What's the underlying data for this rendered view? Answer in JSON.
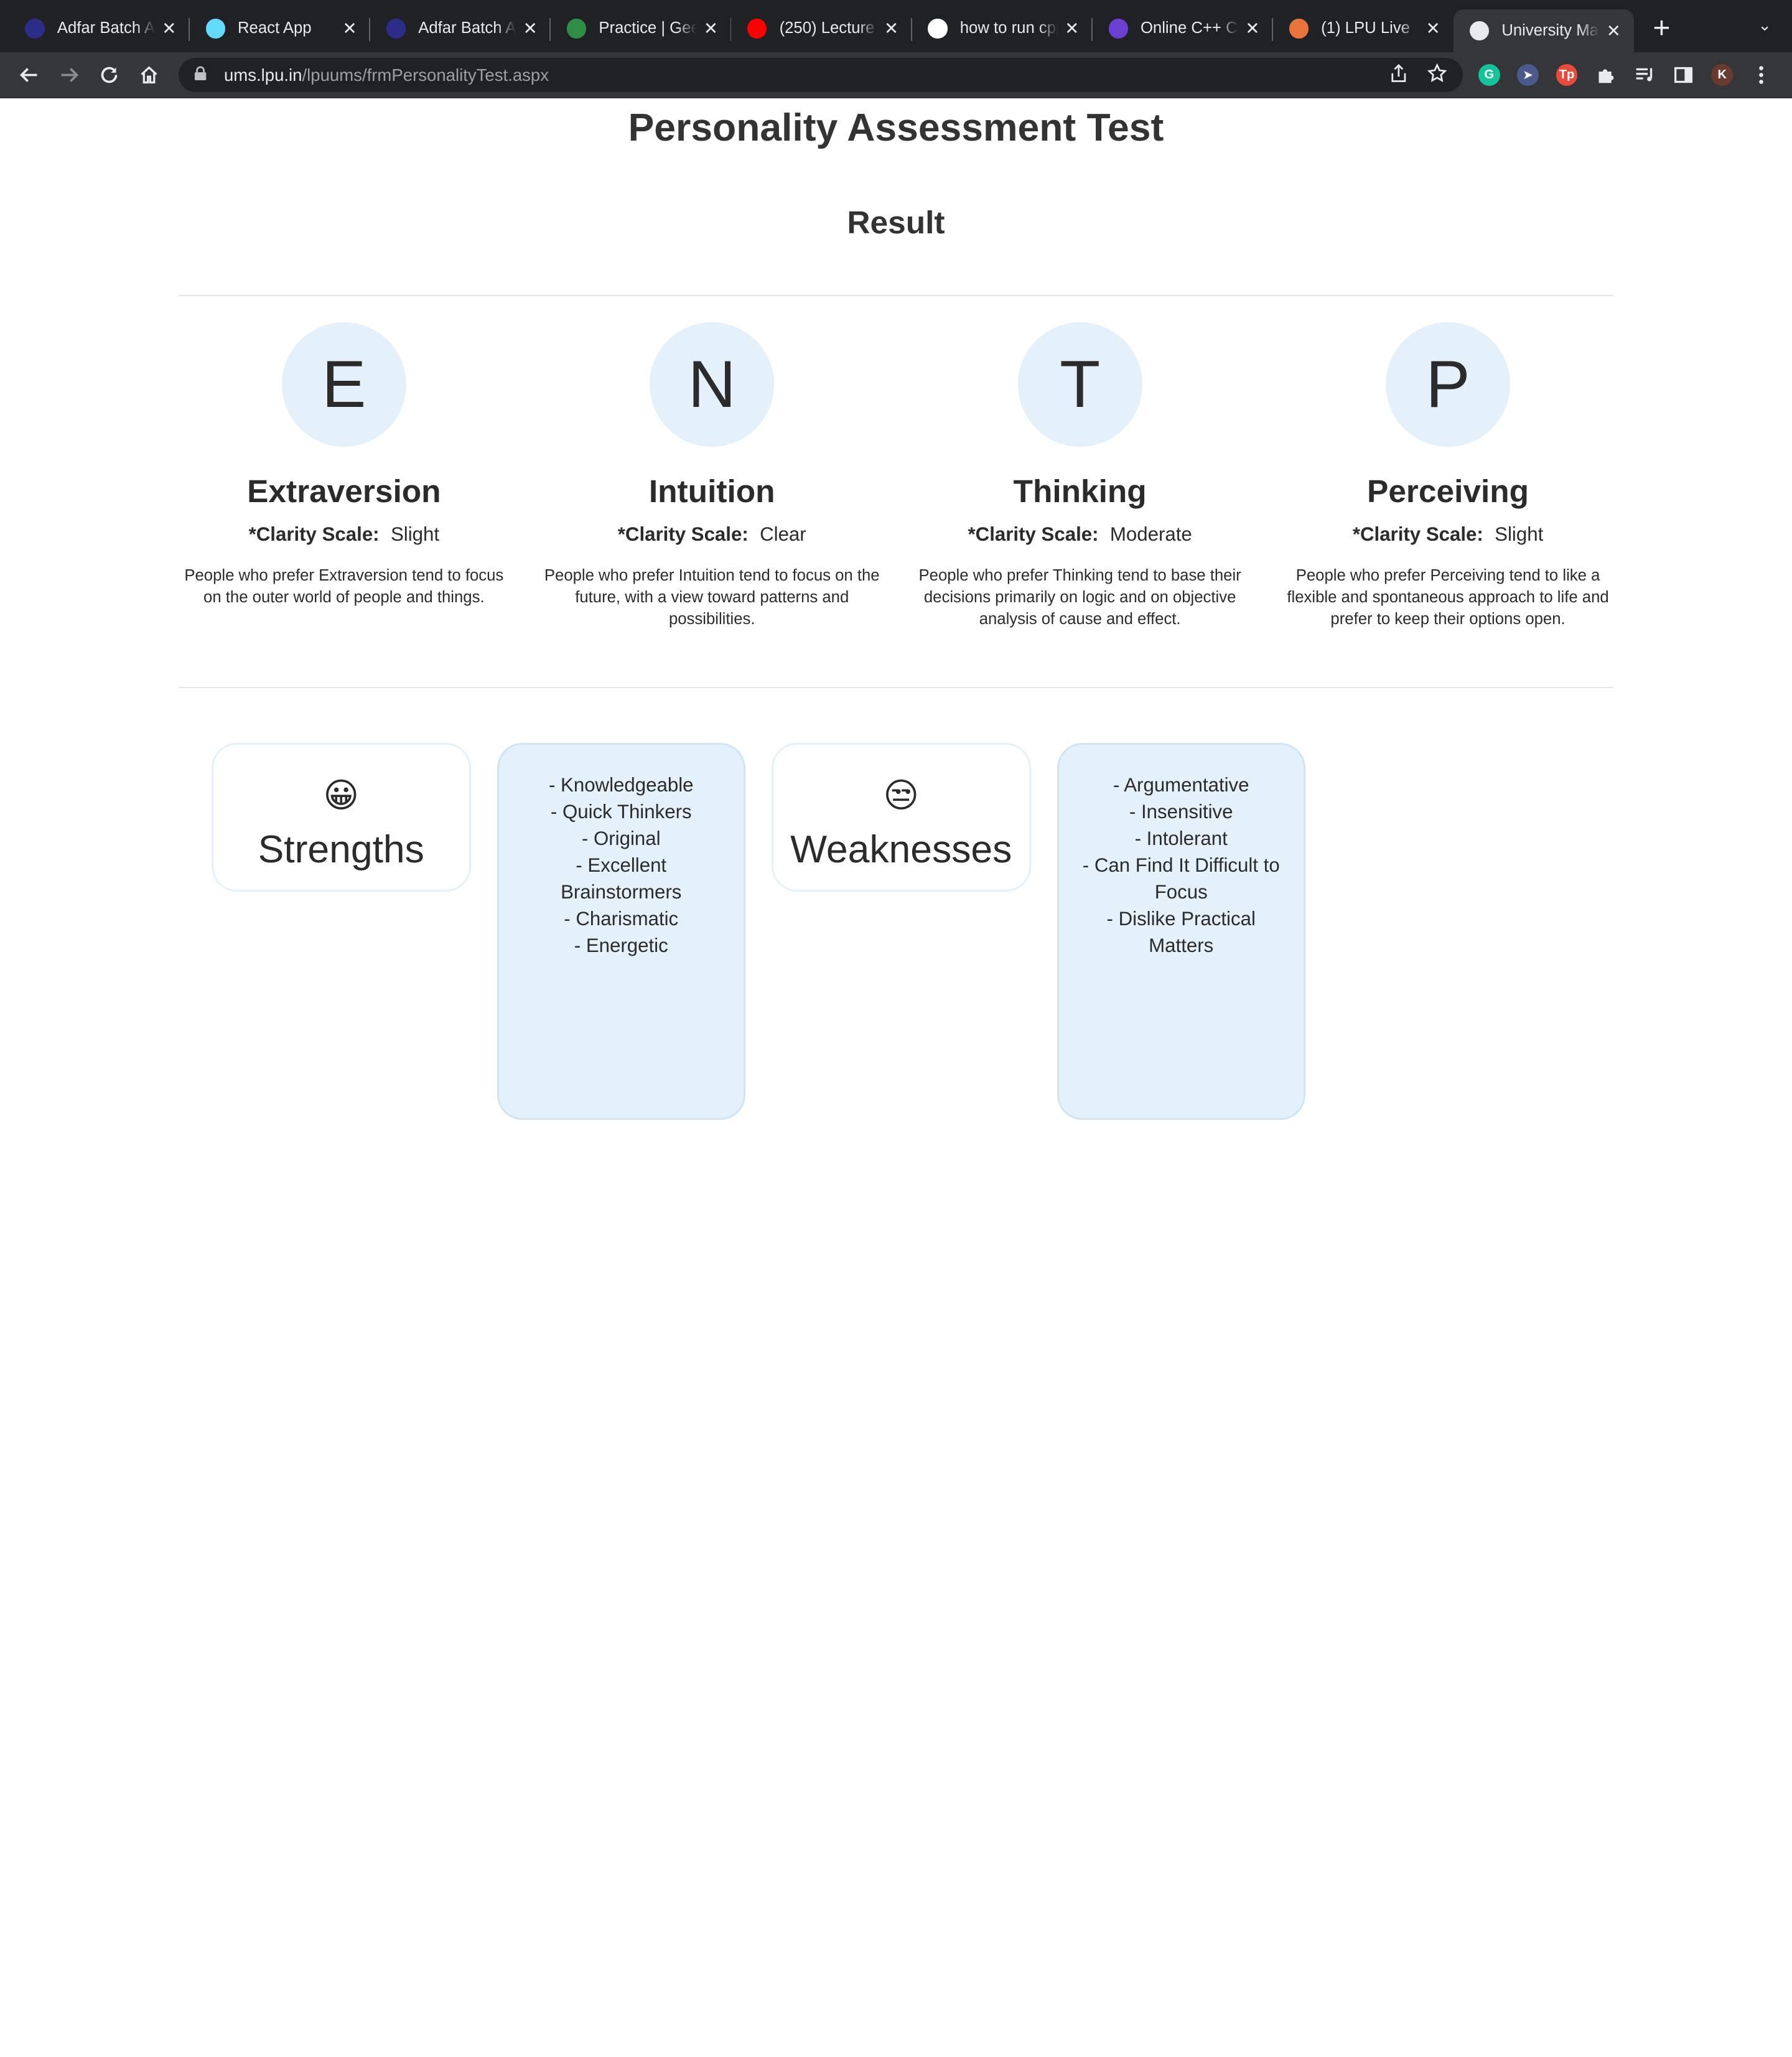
{
  "browser": {
    "tabs": [
      {
        "title": "Adfar Batch A",
        "icon": "coding-platform-icon",
        "color": "#2c2c8a",
        "active": false
      },
      {
        "title": "React App",
        "icon": "react-icon",
        "color": "#61dafb",
        "active": false
      },
      {
        "title": "Adfar Batch A",
        "icon": "coding-platform-icon",
        "color": "#2c2c8a",
        "active": false
      },
      {
        "title": "Practice | Geel",
        "icon": "geeksforgeeks-icon",
        "color": "#2f8d46",
        "active": false
      },
      {
        "title": "(250) Lecture",
        "icon": "youtube-icon",
        "color": "#ff0000",
        "active": false
      },
      {
        "title": "how to run cpp",
        "icon": "google-icon",
        "color": "#ffffff",
        "active": false
      },
      {
        "title": "Online C++ Co",
        "icon": "bolt-icon",
        "color": "#6a3fd1",
        "active": false
      },
      {
        "title": "(1) LPU Live",
        "icon": "lpu-live-icon",
        "color": "#e8743b",
        "active": false
      },
      {
        "title": "University Mar",
        "icon": "globe-icon",
        "color": "#e8eaed",
        "active": true
      }
    ],
    "url_host": "ums.lpu.in",
    "url_path": "/lpuums/frmPersonalityTest.aspx",
    "profile_initial": "K",
    "extensions": [
      {
        "name": "grammarly-icon",
        "glyph": "G",
        "color": "#15c39a"
      },
      {
        "name": "cursor-extension-icon",
        "glyph": "➤",
        "color": "#4b5a8a"
      },
      {
        "name": "tp-extension-icon",
        "glyph": "Tp",
        "color": "#e84a3c"
      }
    ]
  },
  "page": {
    "title": "Personality Assessment Test",
    "result_heading": "Result",
    "clarity_label": "*Clarity Scale:",
    "traits": [
      {
        "letter": "E",
        "name": "Extraversion",
        "clarity": "Slight",
        "description": "People who prefer Extraversion tend to focus on the outer world of people and things."
      },
      {
        "letter": "N",
        "name": "Intuition",
        "clarity": "Clear",
        "description": "People who prefer Intuition tend to focus on the future, with a view toward patterns and possibilities."
      },
      {
        "letter": "T",
        "name": "Thinking",
        "clarity": "Moderate",
        "description": "People who prefer Thinking tend to base their decisions primarily on logic and on objective analysis of cause and effect."
      },
      {
        "letter": "P",
        "name": "Perceiving",
        "clarity": "Slight",
        "description": "People who prefer Perceiving tend to like a flexible and spontaneous approach to life and prefer to keep their options open."
      }
    ],
    "strengths": {
      "emoji": "😀",
      "label": "Strengths",
      "items": [
        "- Knowledgeable",
        "- Quick Thinkers",
        "- Original",
        "- Excellent Brainstormers",
        "- Charismatic",
        "- Energetic"
      ]
    },
    "weaknesses": {
      "emoji": "😒",
      "label": "Weaknesses",
      "items": [
        "- Argumentative",
        "- Insensitive",
        "- Intolerant",
        "- Can Find It Difficult to Focus",
        "- Dislike Practical Matters"
      ]
    }
  }
}
